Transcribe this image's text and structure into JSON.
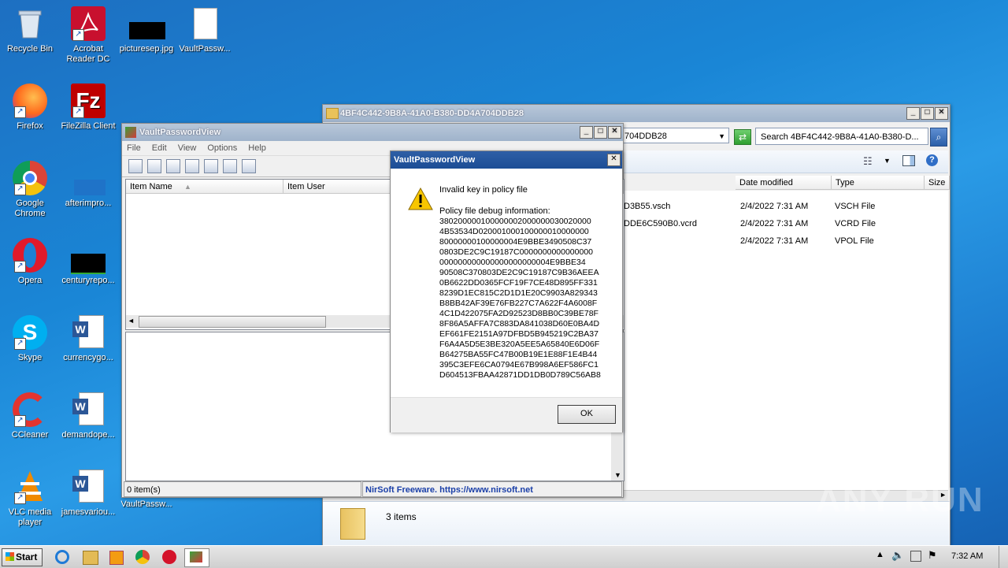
{
  "desktop": {
    "icons": [
      {
        "label": "Recycle Bin"
      },
      {
        "label": "Acrobat Reader DC"
      },
      {
        "label": "picturesep.jpg"
      },
      {
        "label": "VaultPassw..."
      },
      {
        "label": "Firefox"
      },
      {
        "label": "FileZilla Client"
      },
      {
        "label": "Google Chrome"
      },
      {
        "label": "afterimpro..."
      },
      {
        "label": "Opera"
      },
      {
        "label": "centuryrepo..."
      },
      {
        "label": "Skype"
      },
      {
        "label": "currencygo..."
      },
      {
        "label": "CCleaner"
      },
      {
        "label": "demandope..."
      },
      {
        "label": "VLC media player"
      },
      {
        "label": "jamesvariou..."
      },
      {
        "label": "VaultPassw..."
      }
    ]
  },
  "explorer": {
    "title": "4BF4C442-9B8A-41A0-B380-DD4A704DDB28",
    "address_tail": "704DDB28",
    "search_placeholder": "Search 4BF4C442-9B8A-41A0-B380-D...",
    "columns": {
      "date": "Date modified",
      "type": "Type",
      "size": "Size"
    },
    "files": [
      {
        "name": "D3B55.vsch",
        "date": "2/4/2022 7:31 AM",
        "type": "VSCH File"
      },
      {
        "name": "DDE6C590B0.vcrd",
        "date": "2/4/2022 7:31 AM",
        "type": "VCRD File"
      },
      {
        "name": "",
        "date": "2/4/2022 7:31 AM",
        "type": "VPOL File"
      }
    ],
    "details_count": "3 items"
  },
  "vpv": {
    "title": "VaultPasswordView",
    "menu": [
      "File",
      "Edit",
      "View",
      "Options",
      "Help"
    ],
    "col_item_name": "Item Name",
    "col_item_user": "Item User",
    "status_items": "0 item(s)",
    "status_link": "NirSoft Freeware. https://www.nirsoft.net"
  },
  "dialog": {
    "title": "VaultPasswordView",
    "message": "Invalid key in policy file",
    "debug_label": "Policy file debug information:",
    "debug_lines": [
      "380200000100000002000000030020000",
      "4B53534D020001000100000010000000",
      "80000000100000004E9BBE3490508C37",
      "0803DE2C9C19187C0000000000000000",
      "000000000000000000000004E9BBE34",
      "90508C370803DE2C9C19187C9B36AEEA",
      "0B6622DD0365FCF19F7CE48D895FF331",
      "8239D1EC815C2D1D1E20C9903A829343",
      "B8BB42AF39E76FB227C7A622F4A6008F",
      "4C1D422075FA2D92523D8BB0C39BE78F",
      "8F86A5AFFA7C883DA841038D60E0BA4D",
      "EF661FE2151A97DFBD5B945219C2BA37",
      "F6A4A5D5E3BE320A5EE5A65840E6D06F",
      "B64275BA55FC47B00B19E1E88F1E4B44",
      "395C3EFE6CA0794E67B998A6EF586FC1",
      "D604513FBAA42871DD1DB0D789C56AB8"
    ],
    "ok_label": "OK"
  },
  "taskbar": {
    "start_label": "Start",
    "clock": "7:32 AM"
  },
  "watermark": "ANY RUN"
}
